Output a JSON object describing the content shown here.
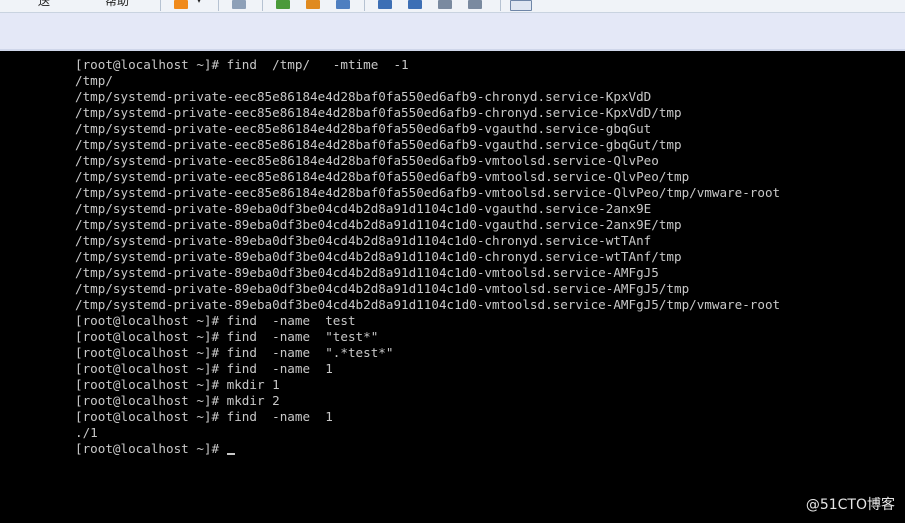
{
  "toolbar": {
    "items": [
      "送",
      "帮助",
      "▾"
    ]
  },
  "terminal": {
    "lines": [
      "[root@localhost ~]# find  /tmp/   -mtime  -1",
      "/tmp/",
      "/tmp/systemd-private-eec85e86184e4d28baf0fa550ed6afb9-chronyd.service-KpxVdD",
      "/tmp/systemd-private-eec85e86184e4d28baf0fa550ed6afb9-chronyd.service-KpxVdD/tmp",
      "/tmp/systemd-private-eec85e86184e4d28baf0fa550ed6afb9-vgauthd.service-gbqGut",
      "/tmp/systemd-private-eec85e86184e4d28baf0fa550ed6afb9-vgauthd.service-gbqGut/tmp",
      "/tmp/systemd-private-eec85e86184e4d28baf0fa550ed6afb9-vmtoolsd.service-QlvPeo",
      "/tmp/systemd-private-eec85e86184e4d28baf0fa550ed6afb9-vmtoolsd.service-QlvPeo/tmp",
      "/tmp/systemd-private-eec85e86184e4d28baf0fa550ed6afb9-vmtoolsd.service-QlvPeo/tmp/vmware-root",
      "/tmp/systemd-private-89eba0df3be04cd4b2d8a91d1104c1d0-vgauthd.service-2anx9E",
      "/tmp/systemd-private-89eba0df3be04cd4b2d8a91d1104c1d0-vgauthd.service-2anx9E/tmp",
      "/tmp/systemd-private-89eba0df3be04cd4b2d8a91d1104c1d0-chronyd.service-wtTAnf",
      "/tmp/systemd-private-89eba0df3be04cd4b2d8a91d1104c1d0-chronyd.service-wtTAnf/tmp",
      "/tmp/systemd-private-89eba0df3be04cd4b2d8a91d1104c1d0-vmtoolsd.service-AMFgJ5",
      "/tmp/systemd-private-89eba0df3be04cd4b2d8a91d1104c1d0-vmtoolsd.service-AMFgJ5/tmp",
      "/tmp/systemd-private-89eba0df3be04cd4b2d8a91d1104c1d0-vmtoolsd.service-AMFgJ5/tmp/vmware-root",
      "[root@localhost ~]# find  -name  test",
      "[root@localhost ~]# find  -name  \"test*\"",
      "[root@localhost ~]# find  -name  \".*test*\"",
      "[root@localhost ~]# find  -name  1",
      "[root@localhost ~]# mkdir 1",
      "[root@localhost ~]# mkdir 2",
      "[root@localhost ~]# find  -name  1",
      "./1"
    ],
    "prompt": "[root@localhost ~]# "
  },
  "watermark": "@51CTO博客",
  "colors": {
    "terminal_bg": "#000000",
    "terminal_fg": "#c8c8c8",
    "toolbar_bg": "#f0f3f8",
    "tabbar_bg": "#e4e8f7"
  }
}
